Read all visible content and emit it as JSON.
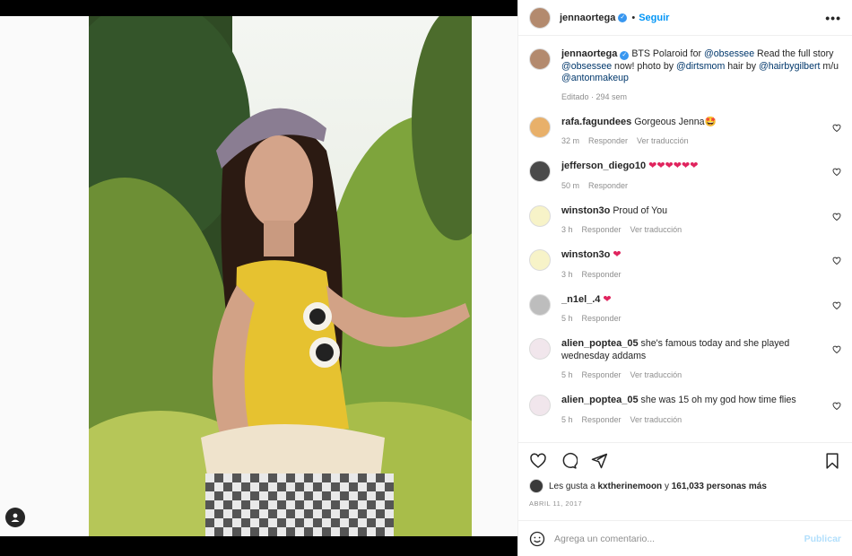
{
  "post": {
    "username": "jennaortega",
    "verified_mark": "✓",
    "dot": "•",
    "follow_label": "Seguir",
    "more_label": "•••",
    "caption_prefix": "BTS Polaroid for ",
    "caption_parts": [
      {
        "t": "BTS Polaroid for ",
        "m": false
      },
      {
        "t": "@obsessee",
        "m": true
      },
      {
        "t": " Read the full story ",
        "m": false
      },
      {
        "t": "@obsessee",
        "m": true
      },
      {
        "t": " now! photo by ",
        "m": false
      },
      {
        "t": "@dirtsmom",
        "m": true
      },
      {
        "t": " hair by ",
        "m": false
      },
      {
        "t": "@hairbygilbert",
        "m": true
      },
      {
        "t": " m/u ",
        "m": false
      },
      {
        "t": "@antonmakeup",
        "m": true
      }
    ],
    "caption_meta": "Editado · 294 sem"
  },
  "comments": [
    {
      "user": "rafa.fagundees",
      "text": "Gorgeous Jenna🤩",
      "hearts": 0,
      "time": "32 m",
      "reply": "Responder",
      "translate": "Ver traducción",
      "avatar_color": "#e8b06a"
    },
    {
      "user": "jefferson_diego10",
      "text": "",
      "hearts": 6,
      "time": "50 m",
      "reply": "Responder",
      "translate": "",
      "avatar_color": "#4a4a4a"
    },
    {
      "user": "winston3o",
      "text": "Proud of You",
      "hearts": 0,
      "time": "3 h",
      "reply": "Responder",
      "translate": "Ver traducción",
      "avatar_color": "#f7f3c8"
    },
    {
      "user": "winston3o",
      "text": "",
      "hearts": 1,
      "time": "3 h",
      "reply": "Responder",
      "translate": "",
      "avatar_color": "#f7f3c8"
    },
    {
      "user": "_n1el_.4",
      "text": "",
      "hearts": 1,
      "time": "5 h",
      "reply": "Responder",
      "translate": "",
      "avatar_color": "#bdbdbd"
    },
    {
      "user": "alien_poptea_05",
      "text": "she's famous today and she played wednesday addams",
      "hearts": 0,
      "time": "5 h",
      "reply": "Responder",
      "translate": "Ver traducción",
      "avatar_color": "#f1e6ec"
    },
    {
      "user": "alien_poptea_05",
      "text": "she was 15 oh my god how time flies",
      "hearts": 0,
      "time": "5 h",
      "reply": "Responder",
      "translate": "Ver traducción",
      "avatar_color": "#f1e6ec"
    }
  ],
  "likes": {
    "prefix": "Les gusta a ",
    "user": "kxtherinemoon",
    "middle": " y ",
    "count": "161,033 personas más"
  },
  "date": "ABRIL 11, 2017",
  "add_comment": {
    "placeholder": "Agrega un comentario...",
    "post_label": "Publicar"
  },
  "icons": {
    "like": "heart-icon",
    "comment": "comment-icon",
    "share": "share-icon",
    "save": "bookmark-icon",
    "emoji": "emoji-icon",
    "user_tag": "user-tag-icon"
  },
  "colors": {
    "accent": "#0095f6",
    "heart": "#e0245e",
    "mention": "#00376b",
    "muted": "#8e8e8e"
  }
}
